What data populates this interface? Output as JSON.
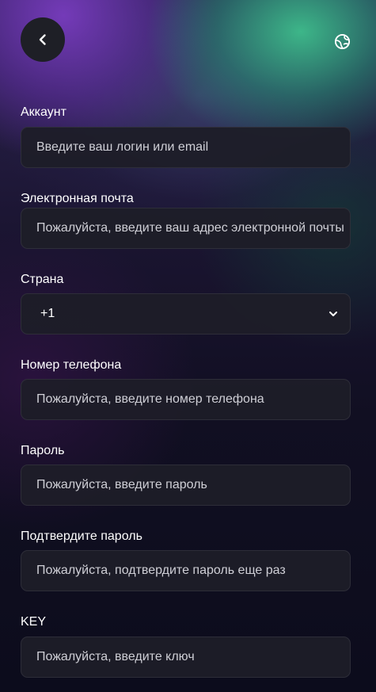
{
  "header": {
    "back_icon": "chevron-left-icon",
    "language_icon": "globe-icon"
  },
  "form": {
    "account": {
      "label": "Аккаунт",
      "placeholder": "Введите ваш логин или email"
    },
    "email": {
      "label": "Электронная почта",
      "placeholder": "Пожалуйста, введите ваш адрес электронной почты"
    },
    "country": {
      "label": "Страна",
      "value": "+1",
      "icon": "chevron-down-icon"
    },
    "phone": {
      "label": "Номер телефона",
      "placeholder": "Пожалуйста, введите номер телефона"
    },
    "password": {
      "label": "Пароль",
      "placeholder": "Пожалуйста, введите пароль"
    },
    "confirm_password": {
      "label": "Подтвердите пароль",
      "placeholder": "Пожалуйста, подтвердите пароль еще раз"
    },
    "key": {
      "label": "KEY",
      "placeholder": "Пожалуйста, введите ключ"
    }
  },
  "colors": {
    "input_background": "#1e1e28",
    "text": "#ffffff",
    "placeholder": "#cfcfd6",
    "gradient_purple": "#7a3cbe",
    "gradient_green": "#3ebe8c"
  }
}
